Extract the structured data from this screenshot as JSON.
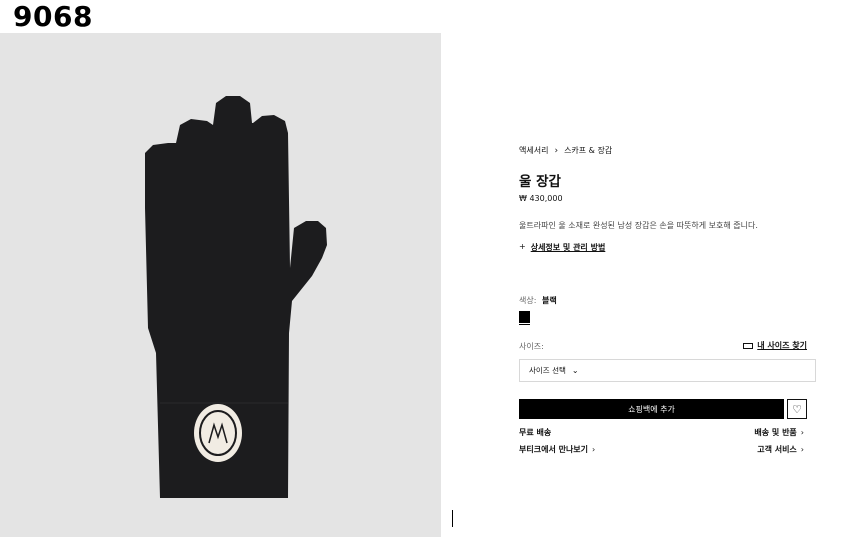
{
  "page_id": "9068",
  "breadcrumb": {
    "parent": "액세서리",
    "current": "스카프 & 장갑"
  },
  "product": {
    "title": "울 장갑",
    "price": "₩ 430,000",
    "description": "울트라파인 울 소재로 완성된 남성 장갑은 손을 따뜻하게 보호해 줍니다.",
    "details_link": "상세정보 및 관리 방법"
  },
  "color": {
    "label": "색상:",
    "value": "블랙",
    "swatch": "#000000"
  },
  "size": {
    "label": "사이즈:",
    "guide": "내 사이즈 찾기",
    "select_value": "사이즈 선택"
  },
  "actions": {
    "add_to_bag": "쇼핑백에 추가"
  },
  "links": {
    "free_shipping": "무료 배송",
    "shipping_returns": "배송 및 반품",
    "boutique": "부티크에서 만나보기",
    "customer_service": "고객 서비스"
  },
  "colors": {
    "image_bg": "#e4e4e4",
    "glove": "#1c1c1e",
    "button": "#000000"
  }
}
